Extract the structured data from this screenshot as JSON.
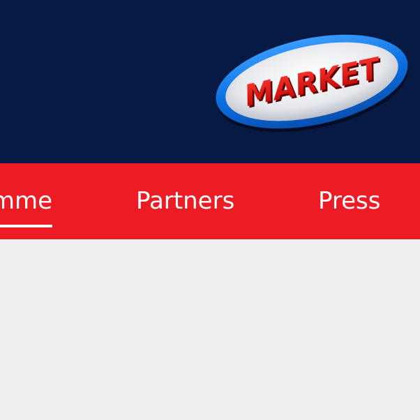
{
  "header": {
    "logo_text": "MARKET",
    "background": "#071a44"
  },
  "nav": {
    "background": "#ed1c24",
    "items": [
      {
        "label": "mme",
        "active": true
      },
      {
        "label": "Partners",
        "active": false
      },
      {
        "label": "Press",
        "active": false
      }
    ]
  },
  "content": {
    "background": "#eeeeee"
  }
}
